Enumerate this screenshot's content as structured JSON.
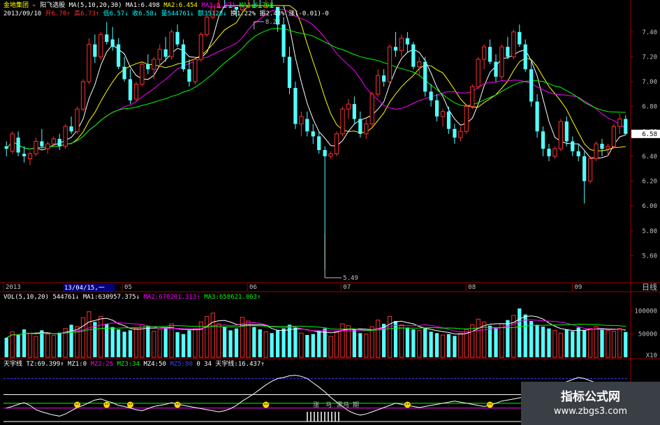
{
  "header": {
    "stock_name": "金地集团",
    "formula_name": "阳飞选股",
    "ma_label": "MA(5,10,20,30)",
    "ma_values": [
      {
        "label": "MA1:6.498",
        "color": "#ffffff"
      },
      {
        "label": "MA2:6.454",
        "color": "#ffff00"
      },
      {
        "label": "MA3:6.671",
        "color": "#ff00ff"
      },
      {
        "label": "MA4:6.768",
        "color": "#00ff00"
      }
    ],
    "date": "2013/09/10",
    "ohlc": [
      {
        "label": "开6.70↑",
        "color": "#ff3030"
      },
      {
        "label": "高6.73↑",
        "color": "#ff3030"
      },
      {
        "label": "低6.57↓",
        "color": "#00ffff"
      },
      {
        "label": "收6.58↓",
        "color": "#00ffff"
      },
      {
        "label": "量544761↓",
        "color": "#00ffff"
      },
      {
        "label": "额35128↓",
        "color": "#00ffff"
      },
      {
        "label": "换1.22%",
        "color": "#ffffff"
      },
      {
        "label": "振2.43%",
        "color": "#ffffff"
      },
      {
        "label": "涨(-0.01)-0",
        "color": "#ffffff"
      }
    ]
  },
  "price_panel": {
    "high_marker": "8.22",
    "low_marker": "5.49",
    "current_price": "6.58"
  },
  "volume_panel": {
    "label": "VOL(5,10,20)",
    "values": [
      {
        "label": "544761↓",
        "color": "#ffffff"
      },
      {
        "label": "MA1:630957.375↓",
        "color": "#ffffff"
      },
      {
        "label": "MA2:670201.313↑",
        "color": "#ff00ff"
      },
      {
        "label": "MA3:658621.063↑",
        "color": "#00ff00"
      }
    ],
    "unit": "X10"
  },
  "indicator_panel": {
    "label": "天宇线",
    "values": [
      {
        "label": "TZ:69.399↑",
        "color": "#ffffff"
      },
      {
        "label": "MZ1:0",
        "color": "#ffffff"
      },
      {
        "label": "MZ2:25",
        "color": "#ff00ff"
      },
      {
        "label": "MZ3:34",
        "color": "#00ff00"
      },
      {
        "label": "MZ4:50",
        "color": "#ffffff"
      },
      {
        "label": "MZ5:80",
        "color": "#4040ff"
      },
      {
        "label": "0",
        "color": "#ffffff"
      },
      {
        "label": "34",
        "color": "#ffffff"
      },
      {
        "label": "天宇线:16.437↑",
        "color": "#ffffff"
      }
    ],
    "annotation_chars": [
      "涨",
      "马",
      "黑马",
      "期"
    ]
  },
  "time_axis": {
    "period_label": "日线",
    "cursor_date": "13/04/15,一"
  },
  "watermark": {
    "title": "指标公式网",
    "url": "www.zbgs3.com"
  },
  "colors": {
    "up": "#ff3030",
    "down": "#54ffff",
    "ma1": "#ffffff",
    "ma2": "#ffff00",
    "ma3": "#ff00ff",
    "ma4": "#00ff00",
    "frame": "#a00000",
    "axis_text": "#c0c0c0"
  },
  "chart_data": [
    {
      "type": "candlestick",
      "title": "金地集团",
      "x_ticks": [
        "2013",
        "05",
        "06",
        "07",
        "08",
        "09"
      ],
      "ylim": [
        5.4,
        7.5
      ],
      "y_ticks": [
        5.6,
        5.8,
        6.0,
        6.2,
        6.4,
        6.6,
        6.8,
        7.0,
        7.2,
        7.4
      ],
      "annotations": {
        "high": 8.22,
        "low": 5.49,
        "last": 6.58
      },
      "candles": [
        [
          6.48,
          6.52,
          6.4,
          6.46
        ],
        [
          6.44,
          6.6,
          6.42,
          6.58
        ],
        [
          6.55,
          6.6,
          6.4,
          6.43
        ],
        [
          6.42,
          6.48,
          6.35,
          6.4
        ],
        [
          6.38,
          6.44,
          6.33,
          6.42
        ],
        [
          6.42,
          6.55,
          6.4,
          6.52
        ],
        [
          6.52,
          6.62,
          6.46,
          6.48
        ],
        [
          6.46,
          6.52,
          6.42,
          6.5
        ],
        [
          6.5,
          6.56,
          6.48,
          6.54
        ],
        [
          6.54,
          6.58,
          6.45,
          6.48
        ],
        [
          6.48,
          6.66,
          6.46,
          6.64
        ],
        [
          6.64,
          6.72,
          6.58,
          6.6
        ],
        [
          6.6,
          6.8,
          6.58,
          6.78
        ],
        [
          6.78,
          7.02,
          6.76,
          7.0
        ],
        [
          7.0,
          7.35,
          6.98,
          7.3
        ],
        [
          7.3,
          7.38,
          7.15,
          7.2
        ],
        [
          7.2,
          7.4,
          7.18,
          7.38
        ],
        [
          7.38,
          7.48,
          7.3,
          7.32
        ],
        [
          7.34,
          7.44,
          7.25,
          7.28
        ],
        [
          7.3,
          7.35,
          7.1,
          7.12
        ],
        [
          7.12,
          7.2,
          7.0,
          7.02
        ],
        [
          7.02,
          7.1,
          6.82,
          6.85
        ],
        [
          6.86,
          7.0,
          6.84,
          6.98
        ],
        [
          6.98,
          7.16,
          6.96,
          7.14
        ],
        [
          7.14,
          7.22,
          7.06,
          7.1
        ],
        [
          7.1,
          7.2,
          7.02,
          7.18
        ],
        [
          7.18,
          7.3,
          7.12,
          7.26
        ],
        [
          7.26,
          7.36,
          7.16,
          7.2
        ],
        [
          7.2,
          7.42,
          7.18,
          7.4
        ],
        [
          7.4,
          7.46,
          7.28,
          7.3
        ],
        [
          7.3,
          7.34,
          7.08,
          7.1
        ],
        [
          7.1,
          7.18,
          6.96,
          7.0
        ],
        [
          7.0,
          7.2,
          6.98,
          7.18
        ],
        [
          7.18,
          7.4,
          7.16,
          7.38
        ],
        [
          7.38,
          7.55,
          7.36,
          7.52
        ],
        [
          7.52,
          7.7,
          7.5,
          7.68
        ],
        [
          7.68,
          7.9,
          7.66,
          7.86
        ],
        [
          7.86,
          8.0,
          7.7,
          7.75
        ],
        [
          7.75,
          7.9,
          7.62,
          7.7
        ],
        [
          7.7,
          7.8,
          7.52,
          7.58
        ],
        [
          7.58,
          7.92,
          7.56,
          7.9
        ],
        [
          7.9,
          8.2,
          7.86,
          8.15
        ],
        [
          8.15,
          8.22,
          7.96,
          8.0
        ],
        [
          8.0,
          8.08,
          7.8,
          7.84
        ],
        [
          7.84,
          7.96,
          7.78,
          7.92
        ],
        [
          7.92,
          7.98,
          7.68,
          7.7
        ],
        [
          7.7,
          7.78,
          7.4,
          7.46
        ],
        [
          7.46,
          7.52,
          7.15,
          7.2
        ],
        [
          7.2,
          7.28,
          6.9,
          6.95
        ],
        [
          6.95,
          7.0,
          6.62,
          6.66
        ],
        [
          6.66,
          6.76,
          6.56,
          6.72
        ],
        [
          6.7,
          6.76,
          6.56,
          6.6
        ],
        [
          6.6,
          6.66,
          6.5,
          6.56
        ],
        [
          6.56,
          6.6,
          6.42,
          6.45
        ],
        [
          6.45,
          6.48,
          5.49,
          6.4
        ],
        [
          6.4,
          6.44,
          6.38,
          6.42
        ],
        [
          6.42,
          6.6,
          6.4,
          6.58
        ],
        [
          6.58,
          6.8,
          6.56,
          6.78
        ],
        [
          6.78,
          6.86,
          6.7,
          6.82
        ],
        [
          6.82,
          6.88,
          6.66,
          6.7
        ],
        [
          6.7,
          6.76,
          6.55,
          6.58
        ],
        [
          6.58,
          6.7,
          6.54,
          6.66
        ],
        [
          6.66,
          6.92,
          6.64,
          6.9
        ],
        [
          6.9,
          7.1,
          6.88,
          7.05
        ],
        [
          7.05,
          7.1,
          6.96,
          7.0
        ],
        [
          7.0,
          7.3,
          6.98,
          7.28
        ],
        [
          7.28,
          7.4,
          7.2,
          7.25
        ],
        [
          7.25,
          7.38,
          7.2,
          7.35
        ],
        [
          7.35,
          7.4,
          7.24,
          7.3
        ],
        [
          7.3,
          7.32,
          7.1,
          7.12
        ],
        [
          7.12,
          7.2,
          7.05,
          7.16
        ],
        [
          7.16,
          7.2,
          6.88,
          6.92
        ],
        [
          6.92,
          6.98,
          6.8,
          6.85
        ],
        [
          6.85,
          6.9,
          6.68,
          6.72
        ],
        [
          6.72,
          6.78,
          6.64,
          6.76
        ],
        [
          6.76,
          6.8,
          6.58,
          6.62
        ],
        [
          6.62,
          6.66,
          6.5,
          6.55
        ],
        [
          6.55,
          6.64,
          6.52,
          6.6
        ],
        [
          6.6,
          6.82,
          6.58,
          6.8
        ],
        [
          6.8,
          6.98,
          6.78,
          6.96
        ],
        [
          6.96,
          7.2,
          6.94,
          7.18
        ],
        [
          7.18,
          7.3,
          7.1,
          7.28
        ],
        [
          7.28,
          7.34,
          7.14,
          7.16
        ],
        [
          7.16,
          7.22,
          7.0,
          7.04
        ],
        [
          7.04,
          7.3,
          7.02,
          7.28
        ],
        [
          7.28,
          7.36,
          7.18,
          7.2
        ],
        [
          7.2,
          7.42,
          7.18,
          7.4
        ],
        [
          7.4,
          7.46,
          7.28,
          7.3
        ],
        [
          7.3,
          7.34,
          7.08,
          7.1
        ],
        [
          7.1,
          7.18,
          6.8,
          6.84
        ],
        [
          6.84,
          6.9,
          6.55,
          6.6
        ],
        [
          6.6,
          6.64,
          6.4,
          6.46
        ],
        [
          6.46,
          6.5,
          6.36,
          6.4
        ],
        [
          6.4,
          6.48,
          6.38,
          6.46
        ],
        [
          6.46,
          6.7,
          6.44,
          6.68
        ],
        [
          6.68,
          6.72,
          6.48,
          6.52
        ],
        [
          6.52,
          6.56,
          6.4,
          6.44
        ],
        [
          6.44,
          6.5,
          6.36,
          6.4
        ],
        [
          6.4,
          6.44,
          6.02,
          6.2
        ],
        [
          6.2,
          6.4,
          6.18,
          6.38
        ],
        [
          6.38,
          6.52,
          6.36,
          6.5
        ],
        [
          6.5,
          6.54,
          6.4,
          6.46
        ],
        [
          6.46,
          6.5,
          6.4,
          6.48
        ],
        [
          6.48,
          6.66,
          6.46,
          6.64
        ],
        [
          6.64,
          6.74,
          6.58,
          6.7
        ],
        [
          6.7,
          6.73,
          6.57,
          6.58
        ]
      ]
    },
    {
      "type": "bar",
      "title": "VOL(5,10,20)",
      "y_ticks": [
        50000,
        100000
      ],
      "unit": "X10",
      "values": [
        42000,
        55000,
        48000,
        60000,
        52000,
        45000,
        58000,
        50000,
        47000,
        53000,
        62000,
        70000,
        66000,
        85000,
        98000,
        76000,
        88000,
        72000,
        65000,
        60000,
        55000,
        58000,
        62000,
        70000,
        68000,
        56000,
        60000,
        64000,
        72000,
        54000,
        50000,
        58000,
        62000,
        76000,
        88000,
        95000,
        72000,
        66000,
        58000,
        62000,
        86000,
        78000,
        65000,
        60000,
        55000,
        52000,
        58000,
        62000,
        70000,
        64000,
        52000,
        48000,
        50000,
        58000,
        62000,
        45000,
        55000,
        72000,
        68000,
        60000,
        52000,
        50000,
        66000,
        80000,
        72000,
        88000,
        78000,
        70000,
        64000,
        60000,
        58000,
        62000,
        55000,
        52000,
        48000,
        50000,
        46000,
        52000,
        60000,
        70000,
        82000,
        76000,
        68000,
        64000,
        72000,
        80000,
        90000,
        105000,
        92000,
        78000,
        70000,
        66000,
        62000,
        58000,
        52000,
        60000,
        56000,
        64000,
        58000,
        62000,
        66000,
        60000,
        58000,
        56000,
        62000,
        54476
      ]
    },
    {
      "type": "line",
      "title": "天宇线",
      "ylim": [
        0,
        100
      ],
      "reference_levels": [
        0,
        25,
        34,
        50,
        80
      ],
      "values": [
        25,
        28,
        32,
        35,
        30,
        22,
        18,
        15,
        12,
        10,
        14,
        20,
        26,
        30,
        35,
        40,
        42,
        38,
        35,
        30,
        28,
        25,
        22,
        20,
        24,
        28,
        30,
        32,
        35,
        33,
        30,
        28,
        26,
        24,
        22,
        20,
        18,
        20,
        24,
        30,
        38,
        45,
        52,
        60,
        68,
        75,
        80,
        82,
        85,
        86,
        84,
        80,
        72,
        64,
        55,
        45,
        36,
        28,
        20,
        15,
        12,
        14,
        18,
        22,
        26,
        30,
        34,
        32,
        30,
        28,
        26,
        28,
        30,
        32,
        34,
        36,
        38,
        36,
        34,
        32,
        30,
        28,
        30,
        34,
        38,
        40,
        42,
        44,
        46,
        50,
        54,
        58,
        62,
        66,
        70,
        74,
        78,
        82,
        80,
        76,
        72,
        70,
        68,
        69,
        70,
        69.4
      ]
    }
  ]
}
